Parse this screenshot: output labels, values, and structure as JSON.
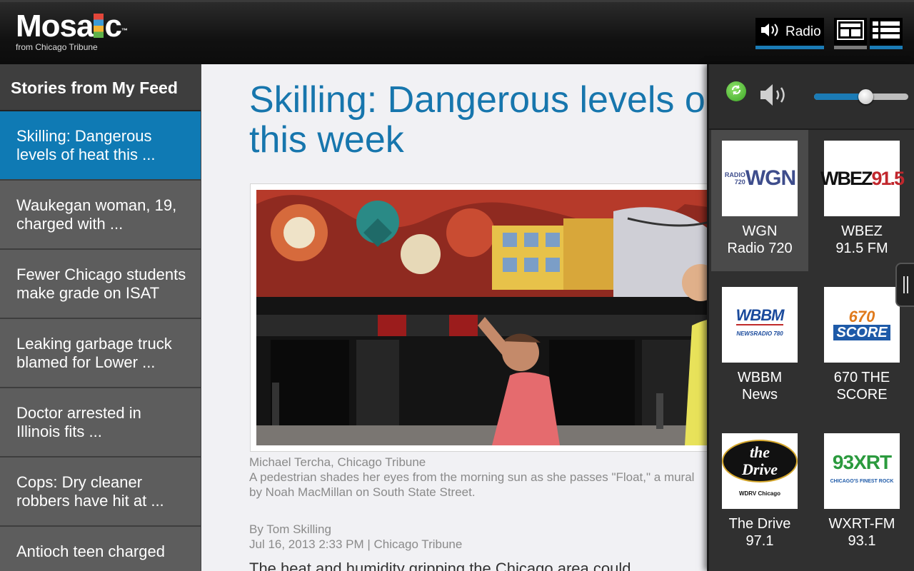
{
  "app": {
    "logo_text_a": "Mosa",
    "logo_text_b": "c",
    "logo_tm": "™",
    "logo_subtitle": "from Chicago Tribune"
  },
  "toolbar": {
    "radio_label": "Radio",
    "speaker_icon": "speaker-icon",
    "grid_view_icon": "grid-view-icon",
    "list_view_icon": "list-view-icon",
    "accent_color": "#1b7bb5"
  },
  "sidebar": {
    "title": "Stories from My Feed",
    "items": [
      {
        "label": "Skilling: Dangerous levels of heat this ...",
        "active": true
      },
      {
        "label": "Waukegan woman, 19, charged with ..."
      },
      {
        "label": "Fewer Chicago students make grade on ISAT"
      },
      {
        "label": "Leaking garbage truck blamed for Lower ..."
      },
      {
        "label": "Doctor arrested in Illinois fits ..."
      },
      {
        "label": "Cops: Dry cleaner robbers have hit at ..."
      },
      {
        "label": "Antioch teen charged"
      }
    ],
    "active_color": "#0f7ab4"
  },
  "article": {
    "headline_line1": "Skilling: Dangerous levels o",
    "headline_line2": "this week",
    "photo_credit": "Michael Tercha, Chicago Tribune",
    "caption": "A pedestrian shades her eyes from the morning sun as she passes \"Float,\" a mural by Noah MacMillan on South State Street.",
    "author": "By Tom Skilling",
    "dateline": "Jul 16, 2013 2:33 PM | Chicago Tribune",
    "body_start": "The heat and humidity gripping the Chicago area could"
  },
  "radio_panel": {
    "refresh_icon": "refresh-icon",
    "volume_icon": "volume-icon",
    "volume_level": 0.55,
    "stations": [
      {
        "name_line1": "WGN",
        "name_line2": "Radio 720",
        "logo_a": "RADIO 720",
        "logo_b": "WGN",
        "selected": true
      },
      {
        "name_line1": "WBEZ",
        "name_line2": "91.5 FM",
        "logo_a": "WBEZ",
        "logo_b": "91.5"
      },
      {
        "name_line1": "WBBM",
        "name_line2": "News",
        "logo_a": "WBBM",
        "logo_b": "NEWSRADIO 780"
      },
      {
        "name_line1": "670 THE",
        "name_line2": "SCORE",
        "logo_a": "670",
        "logo_b": "SCORE"
      },
      {
        "name_line1": "The Drive",
        "name_line2": "97.1",
        "logo_a": "the Drive",
        "logo_b": "WDRV Chicago"
      },
      {
        "name_line1": "WXRT-FM",
        "name_line2": "93.1",
        "logo_a": "93XRT",
        "logo_b": "CHICAGO'S FINEST ROCK"
      }
    ],
    "handle_icon": "drag-handle-icon"
  }
}
